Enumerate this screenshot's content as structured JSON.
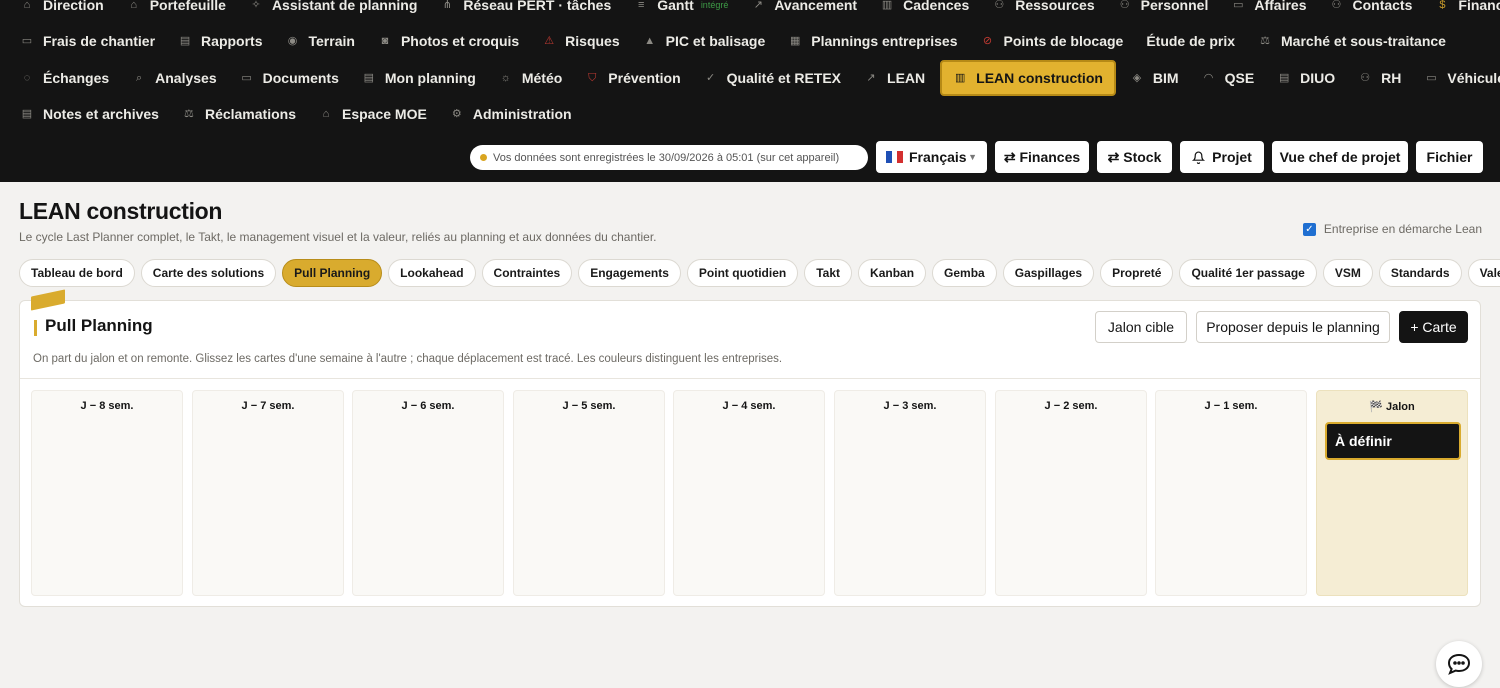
{
  "nav": {
    "rows": [
      [
        {
          "label": "Direction",
          "icon": "home-icon",
          "glyph": "⌂"
        },
        {
          "label": "Portefeuille",
          "icon": "portfolio-icon",
          "glyph": "⌂"
        },
        {
          "label": "Assistant de planning",
          "icon": "sparkle-icon",
          "glyph": "✧"
        },
        {
          "label": "Réseau PERT · tâches",
          "icon": "network-icon",
          "glyph": "⋔"
        },
        {
          "label": "Gantt",
          "icon": "gantt-icon",
          "glyph": "≡",
          "tag": "intégré"
        },
        {
          "label": "Avancement",
          "icon": "trend-icon",
          "glyph": "↗"
        },
        {
          "label": "Cadences",
          "icon": "chart-icon",
          "glyph": "▥"
        },
        {
          "label": "Ressources",
          "icon": "user-plus-icon",
          "glyph": "⚇"
        },
        {
          "label": "Personnel",
          "icon": "users-icon",
          "glyph": "⚇"
        },
        {
          "label": "Affaires",
          "icon": "briefcase-icon",
          "glyph": "▭"
        },
        {
          "label": "Contacts",
          "icon": "contacts-icon",
          "glyph": "⚇"
        },
        {
          "label": "Finances",
          "icon": "dollar-icon",
          "glyph": "$",
          "color": "gold"
        }
      ],
      [
        {
          "label": "Frais de chantier",
          "icon": "wallet-icon",
          "glyph": "▭"
        },
        {
          "label": "Rapports",
          "icon": "report-icon",
          "glyph": "▤"
        },
        {
          "label": "Terrain",
          "icon": "map-pin-icon",
          "glyph": "◉"
        },
        {
          "label": "Photos et croquis",
          "icon": "camera-icon",
          "glyph": "◙"
        },
        {
          "label": "Risques",
          "icon": "warning-icon",
          "glyph": "⚠",
          "color": "red"
        },
        {
          "label": "PIC et balisage",
          "icon": "cone-icon",
          "glyph": "▲"
        },
        {
          "label": "Plannings entreprises",
          "icon": "grid-icon",
          "glyph": "▦"
        },
        {
          "label": "Points de blocage",
          "icon": "block-icon",
          "glyph": "⊘",
          "color": "red"
        },
        {
          "label": "Étude de prix",
          "icon": "",
          "glyph": ""
        },
        {
          "label": "Marché et sous-traitance",
          "icon": "scale-icon",
          "glyph": "⚖"
        }
      ],
      [
        {
          "label": "Échanges",
          "icon": "chat-icon",
          "glyph": "◌"
        },
        {
          "label": "Analyses",
          "icon": "search-icon",
          "glyph": "⌕"
        },
        {
          "label": "Documents",
          "icon": "folder-icon",
          "glyph": "▭"
        },
        {
          "label": "Mon planning",
          "icon": "calendar-icon",
          "glyph": "▤"
        },
        {
          "label": "Météo",
          "icon": "weather-icon",
          "glyph": "☼"
        },
        {
          "label": "Prévention",
          "icon": "shield-icon",
          "glyph": "⛉",
          "color": "red"
        },
        {
          "label": "Qualité et RETEX",
          "icon": "check-icon",
          "glyph": "✓"
        },
        {
          "label": "LEAN",
          "icon": "trend-icon",
          "glyph": "↗"
        },
        {
          "label": "LEAN construction",
          "icon": "bar-chart-icon",
          "glyph": "▥",
          "active": true
        },
        {
          "label": "BIM",
          "icon": "cube-icon",
          "glyph": "◈"
        },
        {
          "label": "QSE",
          "icon": "helmet-icon",
          "glyph": "◠"
        },
        {
          "label": "DIUO",
          "icon": "document-icon",
          "glyph": "▤"
        },
        {
          "label": "RH",
          "icon": "user-icon",
          "glyph": "⚇"
        },
        {
          "label": "Véhicules",
          "icon": "car-icon",
          "glyph": "▭"
        }
      ],
      [
        {
          "label": "Notes et archives",
          "icon": "note-icon",
          "glyph": "▤"
        },
        {
          "label": "Réclamations",
          "icon": "scale-icon",
          "glyph": "⚖"
        },
        {
          "label": "Espace MOE",
          "icon": "building-icon",
          "glyph": "⌂"
        },
        {
          "label": "Administration",
          "icon": "gear-icon",
          "glyph": "⚙"
        }
      ]
    ]
  },
  "toolbar": {
    "save_status": "Vos données sont enregistrées le 30/09/2026 à 05:01 (sur cet appareil)",
    "language": "Français",
    "finances": "⇄ Finances",
    "stock": "⇄ Stock",
    "project": "Projet",
    "manager_view": "Vue chef de projet",
    "file": "Fichier"
  },
  "page": {
    "title": "LEAN construction",
    "subtitle": "Le cycle Last Planner complet, le Takt, le management visuel et la valeur, reliés au planning et aux données du chantier.",
    "lean_checkbox_label": "Entreprise en démarche Lean",
    "lean_checked": true
  },
  "tabs": [
    {
      "label": "Tableau de bord"
    },
    {
      "label": "Carte des solutions"
    },
    {
      "label": "Pull Planning",
      "active": true
    },
    {
      "label": "Lookahead"
    },
    {
      "label": "Contraintes"
    },
    {
      "label": "Engagements"
    },
    {
      "label": "Point quotidien"
    },
    {
      "label": "Takt"
    },
    {
      "label": "Kanban"
    },
    {
      "label": "Gemba"
    },
    {
      "label": "Gaspillages"
    },
    {
      "label": "Propreté"
    },
    {
      "label": "Qualité 1er passage"
    },
    {
      "label": "VSM"
    },
    {
      "label": "Standards"
    },
    {
      "label": "Valeur"
    }
  ],
  "panel": {
    "title": "Pull Planning",
    "subtitle": "On part du jalon et on remonte. Glissez les cartes d'une semaine à l'autre ; chaque déplacement est tracé. Les couleurs distinguent les entreprises.",
    "btn_milestone": "Jalon cible",
    "btn_propose": "Proposer depuis le planning",
    "btn_add_card": "+ Carte",
    "columns": [
      {
        "label": "J − 8 sem."
      },
      {
        "label": "J − 7 sem."
      },
      {
        "label": "J − 6 sem."
      },
      {
        "label": "J − 5 sem."
      },
      {
        "label": "J − 4 sem."
      },
      {
        "label": "J − 3 sem."
      },
      {
        "label": "J − 2 sem."
      },
      {
        "label": "J − 1 sem."
      },
      {
        "label": "🏁 Jalon",
        "milestone": true,
        "card": "À définir"
      }
    ]
  },
  "colors": {
    "nav_bg": "#141414",
    "accent": "#d9ab2e",
    "danger": "#c03a32",
    "integrated_tag": "#3d9a46"
  }
}
